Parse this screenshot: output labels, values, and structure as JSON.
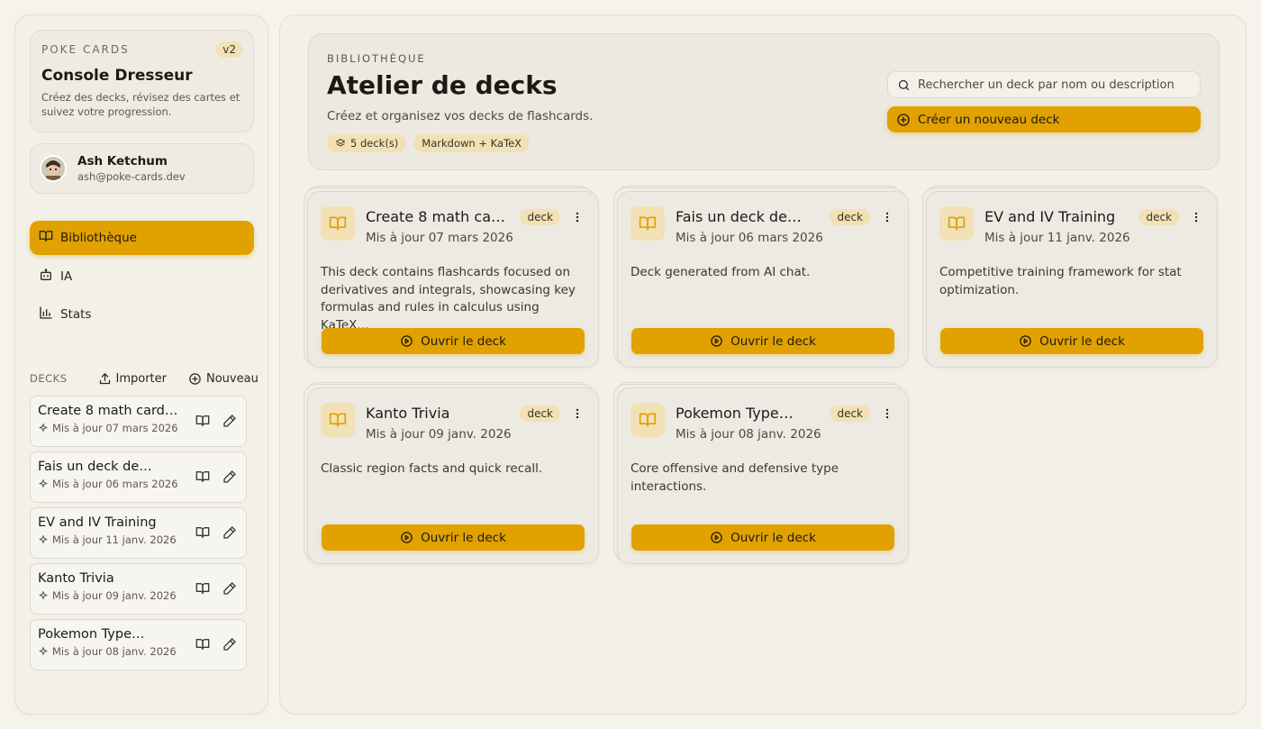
{
  "brand": {
    "eyebrow": "POKE CARDS",
    "version": "v2",
    "title": "Console Dresseur",
    "subtitle": "Créez des decks, révisez des cartes et suivez votre progression."
  },
  "user": {
    "name": "Ash Ketchum",
    "email": "ash@poke-cards.dev"
  },
  "nav": [
    {
      "label": "Bibliothèque",
      "icon": "book-open-icon",
      "active": true
    },
    {
      "label": "IA",
      "icon": "bot-icon",
      "active": false
    },
    {
      "label": "Stats",
      "icon": "bar-chart-icon",
      "active": false
    }
  ],
  "decks_section": {
    "label": "DECKS",
    "import_label": "Importer",
    "new_label": "Nouveau"
  },
  "sidebar_decks": [
    {
      "title": "Create 8 math cards…",
      "date": "Mis à jour 07 mars 2026"
    },
    {
      "title": "Fais un deck de…",
      "date": "Mis à jour 06 mars 2026"
    },
    {
      "title": "EV and IV Training",
      "date": "Mis à jour 11 janv. 2026"
    },
    {
      "title": "Kanto Trivia",
      "date": "Mis à jour 09 janv. 2026"
    },
    {
      "title": "Pokemon Type…",
      "date": "Mis à jour 08 janv. 2026"
    }
  ],
  "hero": {
    "eyebrow": "BIBLIOTHÈQUE",
    "title": "Atelier de decks",
    "subtitle": "Créez et organisez vos decks de flashcards.",
    "chips": [
      "5 deck(s)",
      "Markdown + KaTeX"
    ],
    "search_placeholder": "Rechercher un deck par nom ou description",
    "create_label": "Créer un nouveau deck"
  },
  "cards": [
    {
      "title": "Create 8 math cards…",
      "updated": "Mis à jour 07 mars 2026",
      "badge": "deck",
      "description": "This deck contains flashcards focused on derivatives and integrals, showcasing key formulas and rules in calculus using KaTeX…",
      "open_label": "Ouvrir le deck"
    },
    {
      "title": "Fais un deck de…",
      "updated": "Mis à jour 06 mars 2026",
      "badge": "deck",
      "description": "Deck generated from AI chat.",
      "open_label": "Ouvrir le deck"
    },
    {
      "title": "EV and IV Training",
      "updated": "Mis à jour 11 janv. 2026",
      "badge": "deck",
      "description": "Competitive training framework for stat optimization.",
      "open_label": "Ouvrir le deck"
    },
    {
      "title": "Kanto Trivia",
      "updated": "Mis à jour 09 janv. 2026",
      "badge": "deck",
      "description": "Classic region facts and quick recall.",
      "open_label": "Ouvrir le deck"
    },
    {
      "title": "Pokemon Type…",
      "updated": "Mis à jour 08 janv. 2026",
      "badge": "deck",
      "description": "Core offensive and defensive type interactions.",
      "open_label": "Ouvrir le deck"
    }
  ],
  "colors": {
    "accent": "#e1a100",
    "accent_soft": "#f1e1b5",
    "background": "#f6f3ec"
  }
}
